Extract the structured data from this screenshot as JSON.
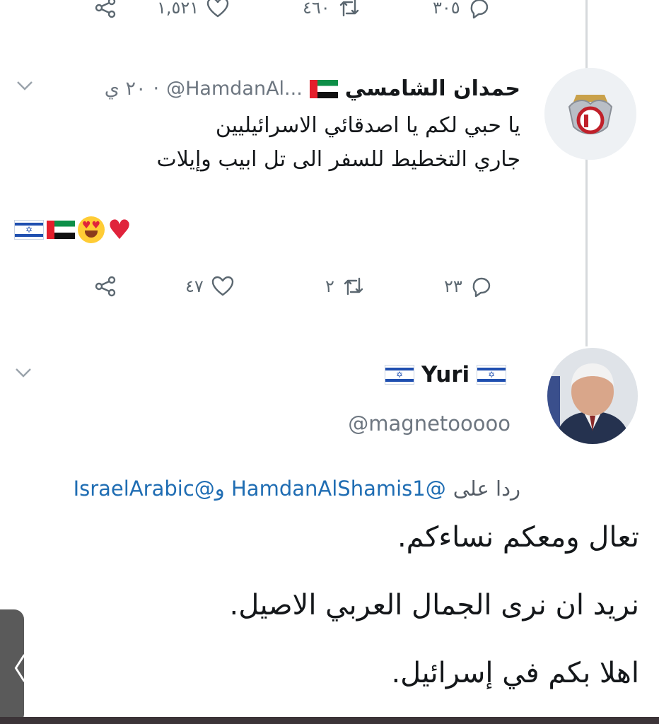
{
  "top_actions": {
    "comments": "٣٠٥",
    "retweets": "٤٦٠",
    "likes": "١,٥٢١"
  },
  "tweet1": {
    "author_name": "حمدان الشامسي",
    "handle": "@HamdanAl...",
    "time": "٢٠ ي",
    "lines": [
      "يا حبي لكم يا اصدقائي الاسرائيليين",
      "جاري التخطيط للسفر الى تل ابيب وإيلات"
    ],
    "emoji_row": [
      "red-heart",
      "heart-eyes-face",
      "uae-flag",
      "israel-flag"
    ],
    "actions": {
      "comments": "٢٣",
      "retweets": "٢",
      "likes": "٤٧"
    }
  },
  "tweet2": {
    "author_name": "Yuri",
    "handle": "@magnetooooo",
    "reply_prefix": "ردا على",
    "reply_mentions": "@HamdanAlShamis1 و@IsraelArabic",
    "lines": [
      "تعال ومعكم نساءكم.",
      "نريد ان نرى الجمال العربي الاصيل.",
      "اهلا بكم في إسرائيل."
    ]
  },
  "side_tab": {
    "label": "〈"
  },
  "colors": {
    "text": "#14171a",
    "muted": "#6d7680",
    "link": "#1f6db3",
    "thread_line": "#d6d9dc"
  }
}
